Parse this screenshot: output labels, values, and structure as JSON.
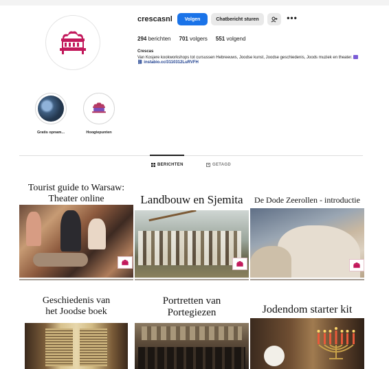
{
  "profile": {
    "username": "crescasnl",
    "follow_label": "Volgen",
    "message_label": "Chatbericht sturen",
    "suggest_icon": "add-person-icon",
    "more_icon": "more-dots-icon",
    "stats": {
      "posts_count": "294",
      "posts_label": "berichten",
      "followers_count": "701",
      "followers_label": "volgers",
      "following_count": "551",
      "following_label": "volgend"
    },
    "bio_name": "Crescas",
    "bio_text": "Van Kosjere kookworkshops tot cursussen Hebreeuws, Joodse kunst, Joodse geschiedenis, Joods muziek en theater.",
    "bio_link": "instabio.cc/3110312LuRVFH",
    "avatar_icon": "crescas-logo-icon"
  },
  "highlights": [
    {
      "label": "Gratis opnam..."
    },
    {
      "label": "Hoogtepunten"
    }
  ],
  "tabs": [
    {
      "label": "BERICHTEN",
      "icon": "grid-icon",
      "active": true
    },
    {
      "label": "GETAGD",
      "icon": "tag-icon",
      "active": false
    }
  ],
  "posts": [
    {
      "title_line1": "Tourist guide to Warsaw:",
      "title_line2": "Theater online"
    },
    {
      "title_line1": "Landbouw en Sjemita",
      "title_line2": ""
    },
    {
      "title_line1": "De Dode Zeerollen - introductie",
      "title_line2": ""
    },
    {
      "title_line1": "Geschiedenis van",
      "title_line2": "het Joodse boek"
    },
    {
      "title_line1": "Portretten van",
      "title_line2": "Portegiezen"
    },
    {
      "title_line1": "Jodendom starter kit",
      "title_line2": ""
    }
  ],
  "colors": {
    "brand": "#c2185b",
    "follow_button": "#1a73e8"
  }
}
